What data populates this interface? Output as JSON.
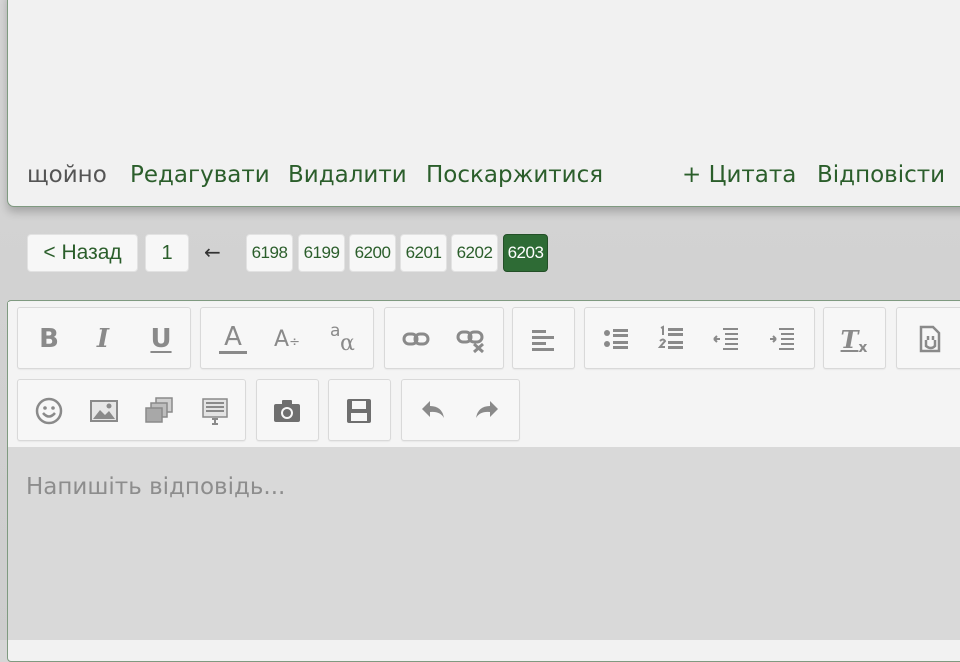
{
  "post": {
    "time": "щойно",
    "actions": [
      "Редагувати",
      "Видалити",
      "Поскаржитися"
    ],
    "quote": "+ Цитата",
    "reply": "Відповісти"
  },
  "pagination": {
    "back": "< Назад",
    "first": "1",
    "ellipsis_arrow": "←",
    "pages": [
      "6198",
      "6199",
      "6200",
      "6201",
      "6202",
      "6203"
    ],
    "current": "6203"
  },
  "editor": {
    "placeholder": "Напишіть відповідь...",
    "toolbar": {
      "bold": "B",
      "italic": "I",
      "underline": "U",
      "font_color": "A",
      "font_size": "A",
      "font_size_suffix": "÷",
      "font_family_top": "a",
      "font_family_bottom": "α",
      "clear_format_letter": "T",
      "clear_format_suffix": "x"
    }
  },
  "colors": {
    "accent": "#2e6b35",
    "link": "#2b5e2b",
    "border": "#7f9a80"
  }
}
